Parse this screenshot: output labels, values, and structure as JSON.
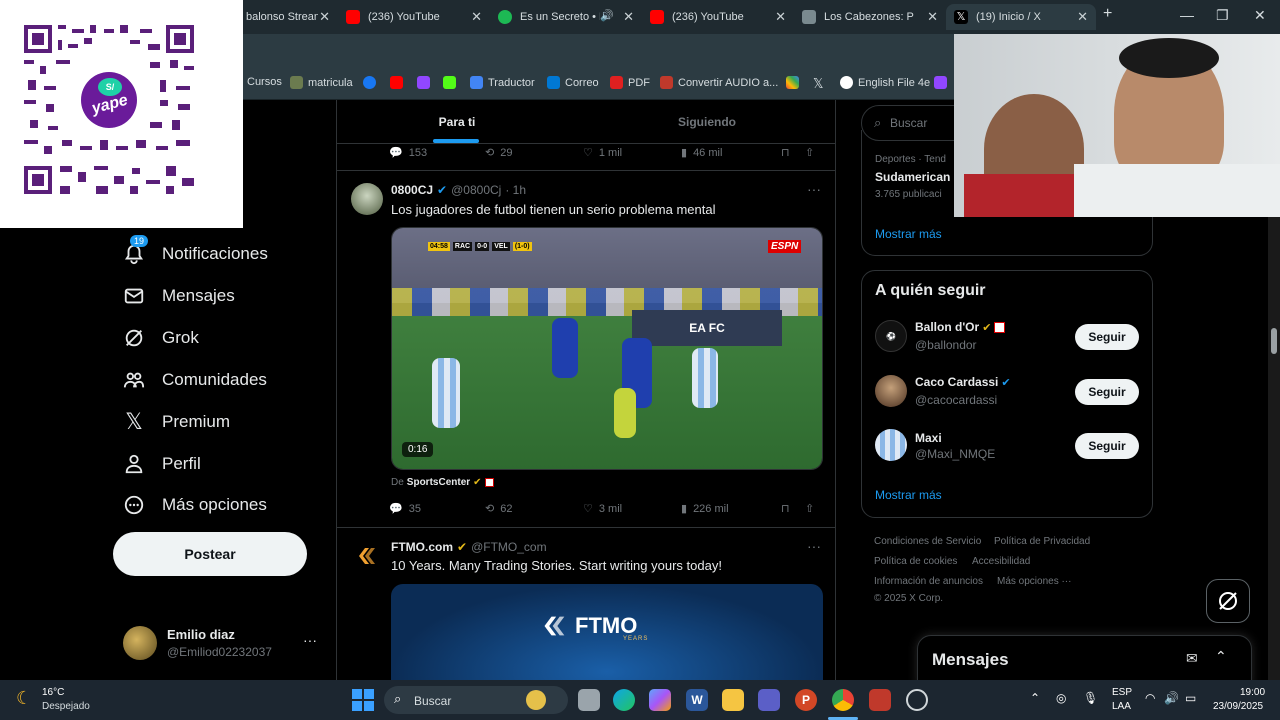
{
  "browser": {
    "tabs": [
      {
        "title": "balonso Strean",
        "color": "#9147ff"
      },
      {
        "title": "(236) YouTube",
        "color": "#ff0000"
      },
      {
        "title": "Es un Secreto • P",
        "color": "#1db954"
      },
      {
        "title": "(236) YouTube",
        "color": "#ff0000"
      },
      {
        "title": "Los Cabezones: P",
        "color": "#7a8a8f"
      },
      {
        "title": "(19) Inicio / X",
        "color": "#000000"
      }
    ],
    "new_tab": "+",
    "bookmarks": [
      "Cursos",
      "matricula",
      "Traductor",
      "Correo",
      "PDF",
      "Convertir AUDIO a...",
      "English File 4e"
    ]
  },
  "overlay": {
    "qr_brand": "yape",
    "qr_symbol": "S/"
  },
  "nav": {
    "badge": "19",
    "items": [
      "Notificaciones",
      "Mensajes",
      "Grok",
      "Comunidades",
      "Premium",
      "Perfil",
      "Más opciones"
    ],
    "post_label": "Postear",
    "user_name": "Emilio diaz",
    "user_handle": "@Emiliod02232037"
  },
  "feed": {
    "tabs": [
      "Para ti",
      "Siguiendo"
    ],
    "prev_actions": {
      "replies": "153",
      "reposts": "29",
      "likes": "1 mil",
      "views": "46 mil"
    },
    "tweet1": {
      "author": "0800CJ",
      "handle": "@0800Cj",
      "time": "· 1h",
      "text": "Los jugadores de futbol tienen un serio problema mental",
      "video_duration": "0:16",
      "scoreboard": {
        "clock": "04:58",
        "home": "RAC",
        "score": "0-0",
        "away": "VEL",
        "agg": "(1-0)"
      },
      "broadcaster": "ESPN",
      "source_prefix": "De",
      "source": "SportsCenter",
      "actions": {
        "replies": "35",
        "reposts": "62",
        "likes": "3 mil",
        "views": "226 mil"
      }
    },
    "tweet2": {
      "author": "FTMO.com",
      "handle": "@FTMO_com",
      "text": "10 Years. Many Trading Stories. Start writing yours today!",
      "banner": "FTMO",
      "banner_sub": "YEARS"
    }
  },
  "right": {
    "search_placeholder": "Buscar",
    "trend_category": "Deportes · Tend",
    "trend_title": "Sudamerican",
    "trend_count": "3.765 publicaci",
    "show_more": "Mostrar más",
    "who_to_follow": "A quién seguir",
    "follow": [
      {
        "name": "Ballon d'Or",
        "handle": "@ballondor"
      },
      {
        "name": "Caco Cardassi",
        "handle": "@cacocardassi"
      },
      {
        "name": "Maxi",
        "handle": "@Maxi_NMQE"
      }
    ],
    "follow_label": "Seguir",
    "footer": [
      "Condiciones de Servicio",
      "Política de Privacidad",
      "Política de cookies",
      "Accesibilidad",
      "Información de anuncios",
      "Más opciones ···",
      "© 2025 X Corp."
    ],
    "messages_title": "Mensajes"
  },
  "taskbar": {
    "weather_temp": "16°C",
    "weather_desc": "Despejado",
    "search_label": "Buscar",
    "lang": "ESP",
    "lang2": "LAA",
    "time": "19:00",
    "date": "23/09/2025"
  }
}
